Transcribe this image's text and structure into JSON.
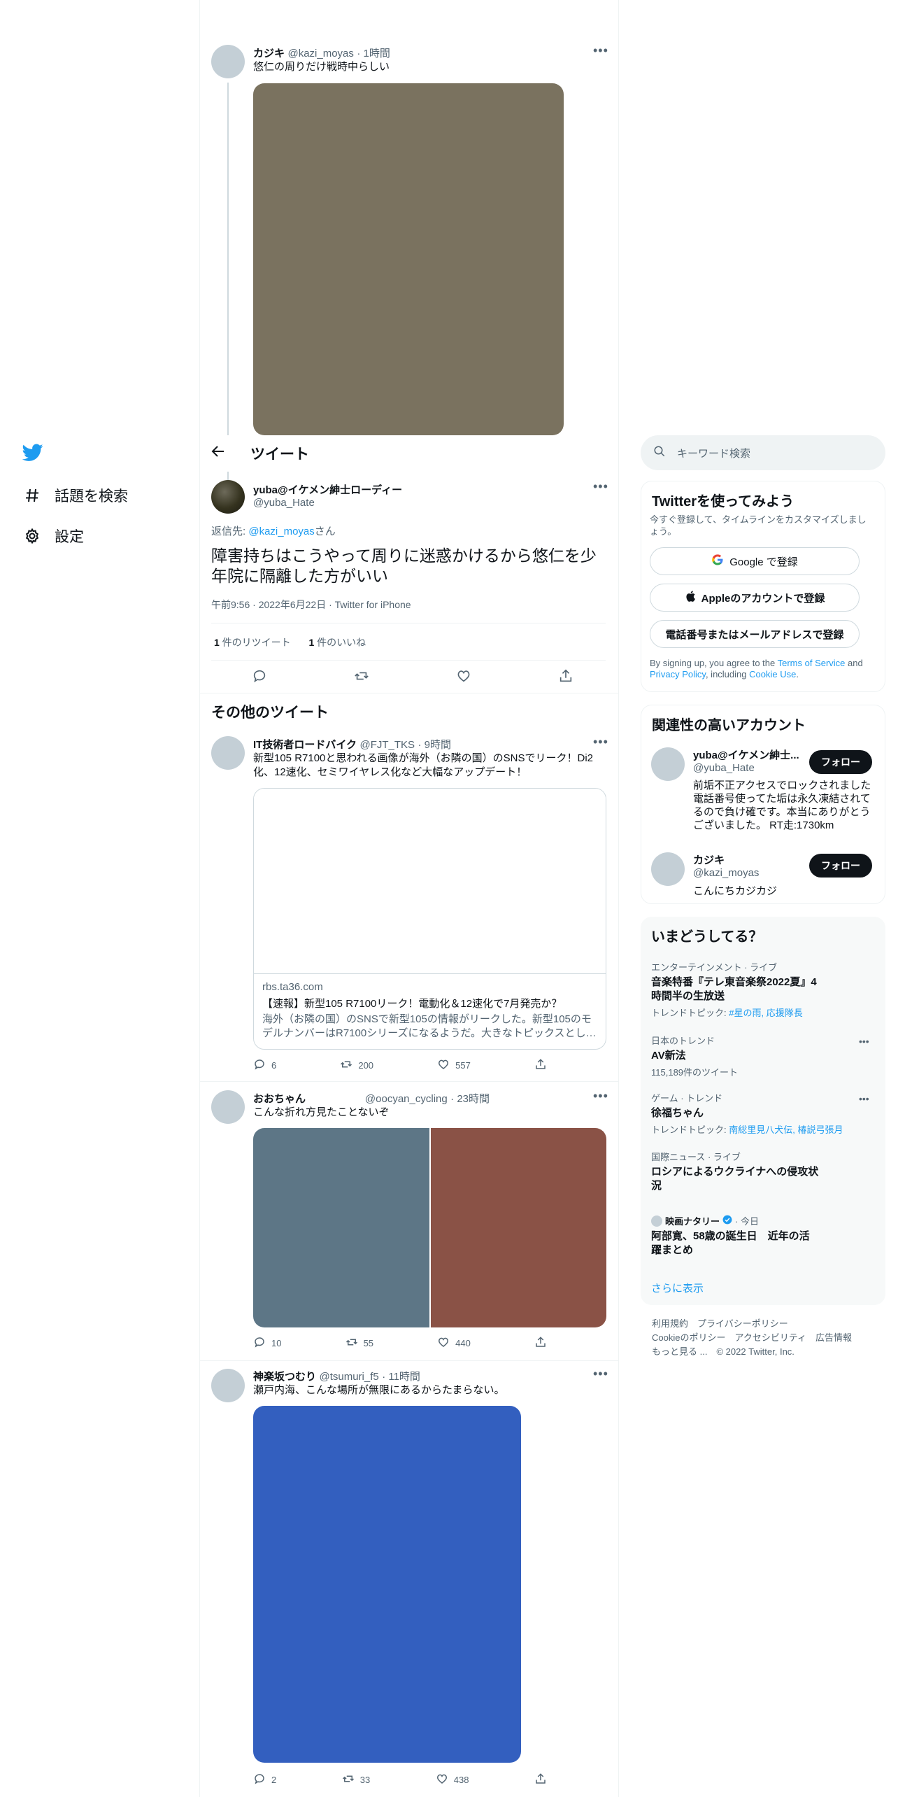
{
  "nav": {
    "explore": "話題を検索",
    "settings": "設定"
  },
  "header": {
    "title": "ツイート"
  },
  "quoted_tweet": {
    "name": "カジキ",
    "handle": "@kazi_moyas",
    "time": "· 1時間",
    "text": "悠仁の周りだけ戦時中らしい",
    "image_color": "#7a725f"
  },
  "main_tweet": {
    "name": "yuba@イケメン紳士ローディー",
    "handle": "@yuba_Hate",
    "reply_prefix": "返信先: ",
    "reply_to": "@kazi_moyas",
    "reply_suffix": "さん",
    "text": "障害持ちはこうやって周りに迷惑かけるから悠仁を少年院に隔離した方がいい",
    "meta": "午前9:56 · 2022年6月22日 · Twitter for iPhone",
    "retweets_count": "1",
    "retweets_label": " 件のリツイート",
    "likes_count": "1",
    "likes_label": " 件のいいね"
  },
  "more_tweets": {
    "heading": "その他のツイート",
    "items": [
      {
        "name": "IT技術者ロードバイク",
        "handle": "@FJT_TKS",
        "time": "· 9時間",
        "text": "新型105 R7100と思われる画像が海外（お隣の国）のSNSでリーク！Di2化、12速化、セミワイヤレス化など大幅なアップデート！",
        "card_domain": "rbs.ta36.com",
        "card_title": "【速報】新型105 R7100リーク！電動化＆12速化で7月発売か？",
        "card_desc": "海外（お隣の国）のSNSで新型105の情報がリークした。新型105のモデルナンバーはR7100シリーズになるようだ。大きなトピックスとし…",
        "replies": "6",
        "retweets": "200",
        "likes": "557"
      },
      {
        "name": "おおちゃん",
        "handle": "@oocyan_cycling",
        "time": "· 23時間",
        "text": "こんな折れ方見たことないぞ",
        "image_left_color": "#5d7686",
        "image_right_color": "#8a5246",
        "replies": "10",
        "retweets": "55",
        "likes": "440"
      },
      {
        "name": "神楽坂つむり",
        "handle": "@tsumuri_f5",
        "time": "· 11時間",
        "text": "瀬戸内海、こんな場所が無限にあるからたまらない。",
        "image_color": "#335fbf",
        "replies": "2",
        "retweets": "33",
        "likes": "438"
      }
    ]
  },
  "search": {
    "placeholder": "キーワード検索"
  },
  "signup": {
    "title": "Twitterを使ってみよう",
    "subtitle": "今すぐ登録して、タイムラインをカスタマイズしましょう。",
    "google": "Google で登録",
    "apple": "Appleのアカウントで登録",
    "phone": "電話番号またはメールアドレスで登録",
    "legal_1": "By signing up, you agree to the ",
    "tos": "Terms of Service",
    "legal_2": " and ",
    "privacy": "Privacy Policy",
    "legal_3": ", including ",
    "cookie": "Cookie Use",
    "legal_4": "."
  },
  "relevant": {
    "title": "関連性の高いアカウント",
    "accounts": [
      {
        "name": "yuba@イケメン紳士...",
        "handle": "@yuba_Hate",
        "bio": "前垢不正アクセスでロックされました 電話番号使ってた垢は永久凍結されてるので負け確です。本当にありがとうございました。 RT走:1730km",
        "button": "フォロー"
      },
      {
        "name": "カジキ",
        "handle": "@kazi_moyas",
        "bio": "こんにちカジカジ",
        "button": "フォロー"
      }
    ]
  },
  "trends": {
    "title": "いまどうしてる？",
    "items": [
      {
        "category": "エンターテインメント · ライブ",
        "title": "音楽特番『テレ東音楽祭2022夏』4時間半の生放送",
        "sub_prefix": "トレンドトピック: ",
        "sub_link": "#星の雨, 応援隊長"
      },
      {
        "category": "日本のトレンド",
        "title": "AV新法",
        "sub": "115,189件のツイート"
      },
      {
        "category": "ゲーム · トレンド",
        "title": "徐福ちゃん",
        "sub_prefix": "トレンドトピック: ",
        "sub_link": "南総里見八犬伝, 椿説弓張月"
      },
      {
        "category": "国際ニュース · ライブ",
        "title": "ロシアによるウクライナへの侵攻状況"
      },
      {
        "source": "映画ナタリー",
        "time": "· 今日",
        "title": "阿部寛、58歳の誕生日　近年の活躍まとめ"
      }
    ],
    "show_more": "さらに表示"
  },
  "footer": {
    "line1": "利用規約　プライバシーポリシー",
    "line2": "Cookieのポリシー　アクセシビリティ　広告情報",
    "line3": "もっと見る ...　© 2022 Twitter, Inc."
  },
  "colors": {
    "accent": "#1d9bf0",
    "text": "#0f1419",
    "secondary": "#536471"
  }
}
